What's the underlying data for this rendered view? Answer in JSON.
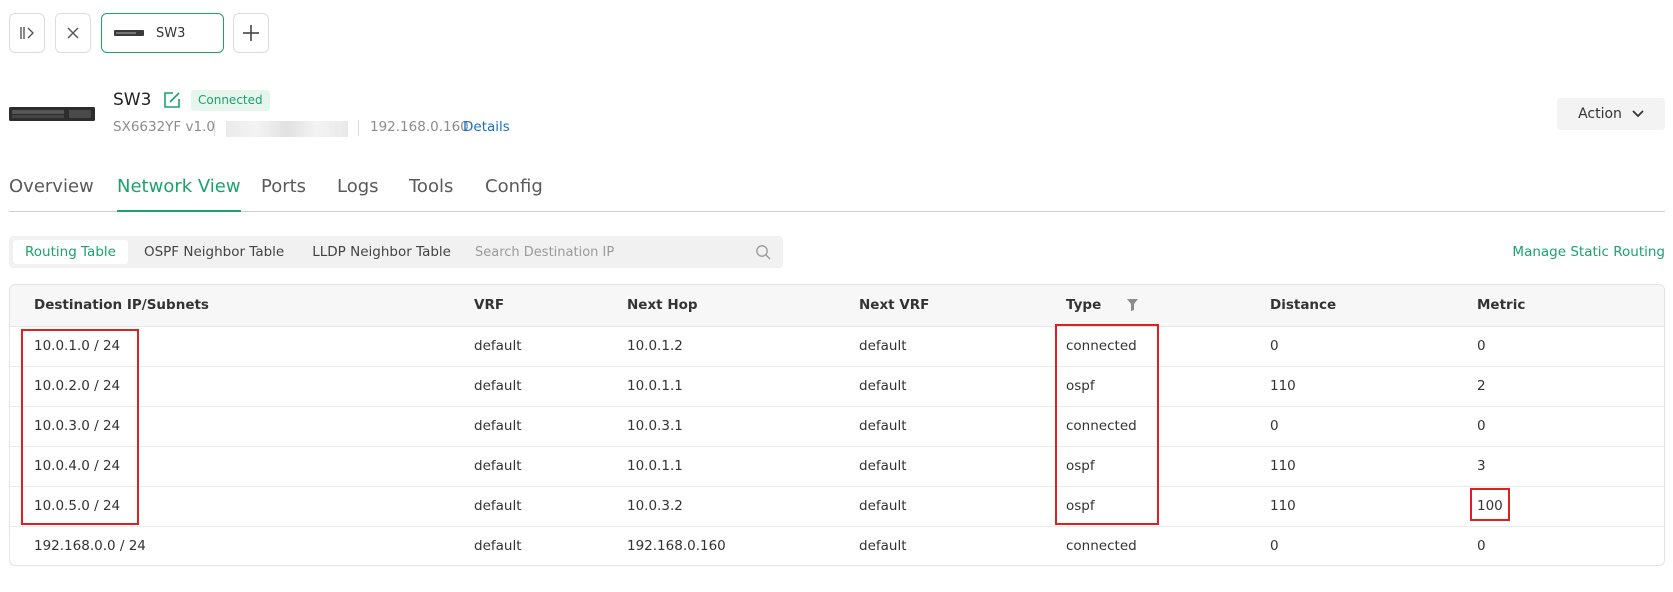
{
  "toolbar": {
    "device_tab_label": "SW3"
  },
  "device": {
    "name": "SW3",
    "status": "Connected",
    "model": "SX6632YF v1.0",
    "ip": "192.168.0.160",
    "details_label": "Details",
    "action_label": "Action"
  },
  "nav": {
    "tabs": [
      "Overview",
      "Network View",
      "Ports",
      "Logs",
      "Tools",
      "Config"
    ],
    "active": "Network View"
  },
  "subnav": {
    "tabs": [
      "Routing Table",
      "OSPF Neighbor Table",
      "LLDP Neighbor Table"
    ],
    "active": "Routing Table",
    "search_placeholder": "Search Destination IP",
    "manage_label": "Manage Static Routing"
  },
  "table": {
    "columns": [
      "Destination IP/Subnets",
      "VRF",
      "Next Hop",
      "Next VRF",
      "Type",
      "Distance",
      "Metric"
    ],
    "rows": [
      [
        "10.0.1.0 / 24",
        "default",
        "10.0.1.2",
        "default",
        "connected",
        "0",
        "0"
      ],
      [
        "10.0.2.0 / 24",
        "default",
        "10.0.1.1",
        "default",
        "ospf",
        "110",
        "2"
      ],
      [
        "10.0.3.0 / 24",
        "default",
        "10.0.3.1",
        "default",
        "connected",
        "0",
        "0"
      ],
      [
        "10.0.4.0 / 24",
        "default",
        "10.0.1.1",
        "default",
        "ospf",
        "110",
        "3"
      ],
      [
        "10.0.5.0 / 24",
        "default",
        "10.0.3.2",
        "default",
        "ospf",
        "110",
        "100"
      ],
      [
        "192.168.0.0 / 24",
        "default",
        "192.168.0.160",
        "default",
        "connected",
        "0",
        "0"
      ]
    ]
  },
  "colors": {
    "accent": "#1ba36b",
    "link": "#1a6fc4",
    "annotation": "#e02020"
  }
}
